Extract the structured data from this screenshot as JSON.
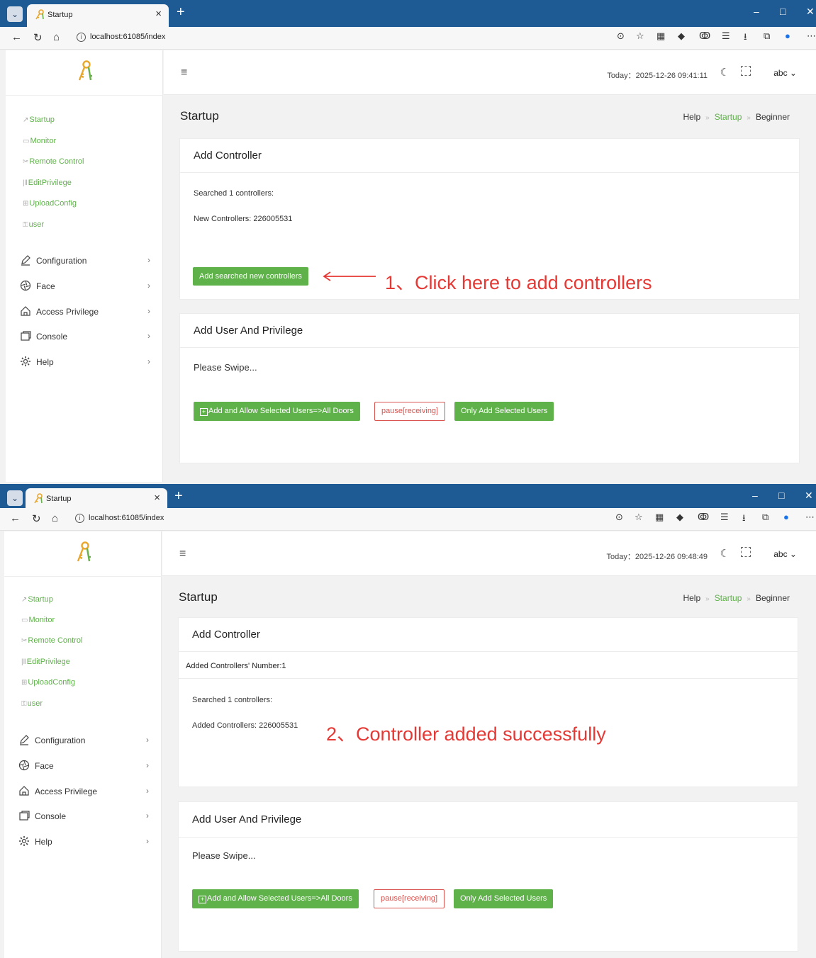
{
  "browser": {
    "tab_title": "Startup",
    "tab_close": "×",
    "new_tab": "+",
    "url": "localhost:61085/index",
    "window": {
      "minimize": "–",
      "maximize": "□",
      "close": "✕"
    }
  },
  "sidebar": {
    "quick_links": [
      {
        "icon": "↗",
        "label": "Startup"
      },
      {
        "icon": "▭",
        "label": "Monitor"
      },
      {
        "icon": "✂",
        "label": "Remote Control"
      },
      {
        "icon": "|‖",
        "label": "EditPrivilege"
      },
      {
        "icon": "⊞",
        "label": "UploadConfig"
      },
      {
        "icon": "⚿",
        "label": "user"
      }
    ],
    "menu": [
      {
        "label": "Configuration",
        "icon": "pencil-icon"
      },
      {
        "label": "Face",
        "icon": "aperture-icon"
      },
      {
        "label": "Access Privilege",
        "icon": "home-icon"
      },
      {
        "label": "Console",
        "icon": "window-icon"
      },
      {
        "label": "Help",
        "icon": "gear-icon"
      }
    ],
    "chevron": "›"
  },
  "header": {
    "user": "abc ⌄"
  },
  "page": {
    "title": "Startup",
    "breadcrumb": [
      "Help",
      "Startup",
      "Beginner"
    ],
    "breadcrumb_sep": "»"
  },
  "add_user": {
    "title": "Add User And Privilege",
    "status": "Please Swipe...",
    "btn_add_allow": "Add and Allow Selected Users=>All Doors",
    "btn_plus": "+",
    "btn_pause": "pause[receiving]",
    "btn_only_add": "Only Add Selected Users"
  },
  "shot1": {
    "today": "Today：2025-12-26 09:41:11",
    "controller_title": "Add Controller",
    "searched": "Searched 1 controllers:",
    "new_controllers": "New Controllers: 226005531",
    "add_button": "Add searched new controllers",
    "annotation": "1、Click here to add controllers"
  },
  "shot2": {
    "today": "Today：2025-12-26 09:48:49",
    "controller_title": "Add Controller",
    "added_number": "Added Controllers' Number:1",
    "searched": "Searched 1 controllers:",
    "added_controllers": "Added Controllers: 226005531",
    "annotation": "2、Controller added successfully"
  },
  "colors": {
    "accent": "#5fb14a",
    "chrome": "#1e5b94",
    "annotation": "#e53935",
    "danger": "#d9534f"
  }
}
